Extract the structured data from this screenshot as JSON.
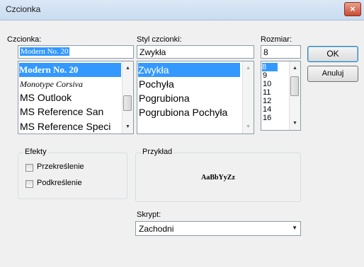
{
  "window": {
    "title": "Czcionka",
    "close_glyph": "×"
  },
  "font": {
    "label": "Czcionka:",
    "accel": "n",
    "value": "Modern No. 20",
    "items": [
      "Modern No. 20",
      "Monotype Corsiva",
      "MS Outlook",
      "MS Reference San",
      "MS Reference Speci"
    ]
  },
  "style": {
    "label": "Styl czcionki:",
    "accel": "S",
    "value": "Zwykła",
    "items": [
      "Zwykła",
      "Pochyła",
      "Pogrubiona",
      "Pogrubiona Pochyła"
    ]
  },
  "size": {
    "label": "Rozmiar:",
    "accel": "R",
    "value": "8",
    "items": [
      "8",
      "9",
      "10",
      "11",
      "12",
      "14",
      "16"
    ]
  },
  "buttons": {
    "ok": "OK",
    "cancel": "Anuluj"
  },
  "effects": {
    "legend": "Efekty",
    "strike": {
      "label": "Przekreślenie",
      "checked": false
    },
    "underline": {
      "label": "Podkreślenie",
      "checked": false
    }
  },
  "sample": {
    "legend": "Przykład",
    "text": "AaBbYyZz"
  },
  "script": {
    "label": "Skrypt:",
    "value": "Zachodni"
  },
  "colors": {
    "selection": "#3399ff",
    "close": "#c94b33"
  }
}
